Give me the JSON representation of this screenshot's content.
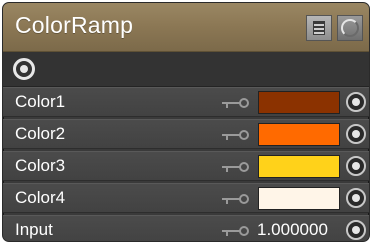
{
  "node": {
    "title": "ColorRamp",
    "header_buttons": [
      {
        "name": "list-icon"
      },
      {
        "name": "preview-sphere-icon"
      }
    ],
    "output_icon": "output-socket-icon"
  },
  "rows": [
    {
      "label": "Color1",
      "type": "color",
      "color": "#8b3200",
      "key_icon": "key-icon",
      "socket_icon": "input-socket-icon"
    },
    {
      "label": "Color2",
      "type": "color",
      "color": "#ff6a00",
      "key_icon": "key-icon",
      "socket_icon": "input-socket-icon"
    },
    {
      "label": "Color3",
      "type": "color",
      "color": "#ffd21a",
      "key_icon": "key-icon",
      "socket_icon": "input-socket-icon"
    },
    {
      "label": "Color4",
      "type": "color",
      "color": "#fff5e8",
      "key_icon": "key-icon",
      "socket_icon": "input-socket-icon"
    },
    {
      "label": "Input",
      "type": "value",
      "value": "1.000000",
      "key_icon": "key-icon",
      "socket_icon": "input-socket-icon"
    }
  ],
  "colors": {
    "header": "#8b7754",
    "body": "#3a3a3a",
    "row": "#474747"
  }
}
